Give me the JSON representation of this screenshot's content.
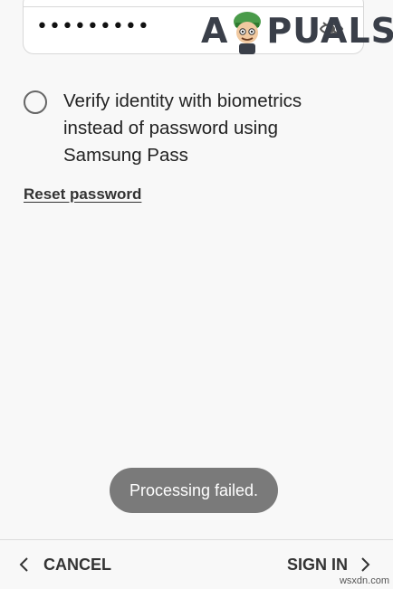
{
  "password": {
    "masked_value": "•••••••••",
    "visibility_icon": "eye-icon"
  },
  "logo": {
    "text_left": "A",
    "text_right": "PUALS"
  },
  "biometrics": {
    "label": "Verify identity with biometrics instead of password using Samsung Pass",
    "checked": false
  },
  "reset_link": "Reset password",
  "toast": "Processing failed.",
  "bottom_bar": {
    "cancel_label": "CANCEL",
    "signin_label": "SIGN IN"
  },
  "watermark": "wsxdn.com",
  "colors": {
    "background": "#f8f8f8",
    "toast_bg": "#7a7a7a",
    "text": "#222222"
  }
}
